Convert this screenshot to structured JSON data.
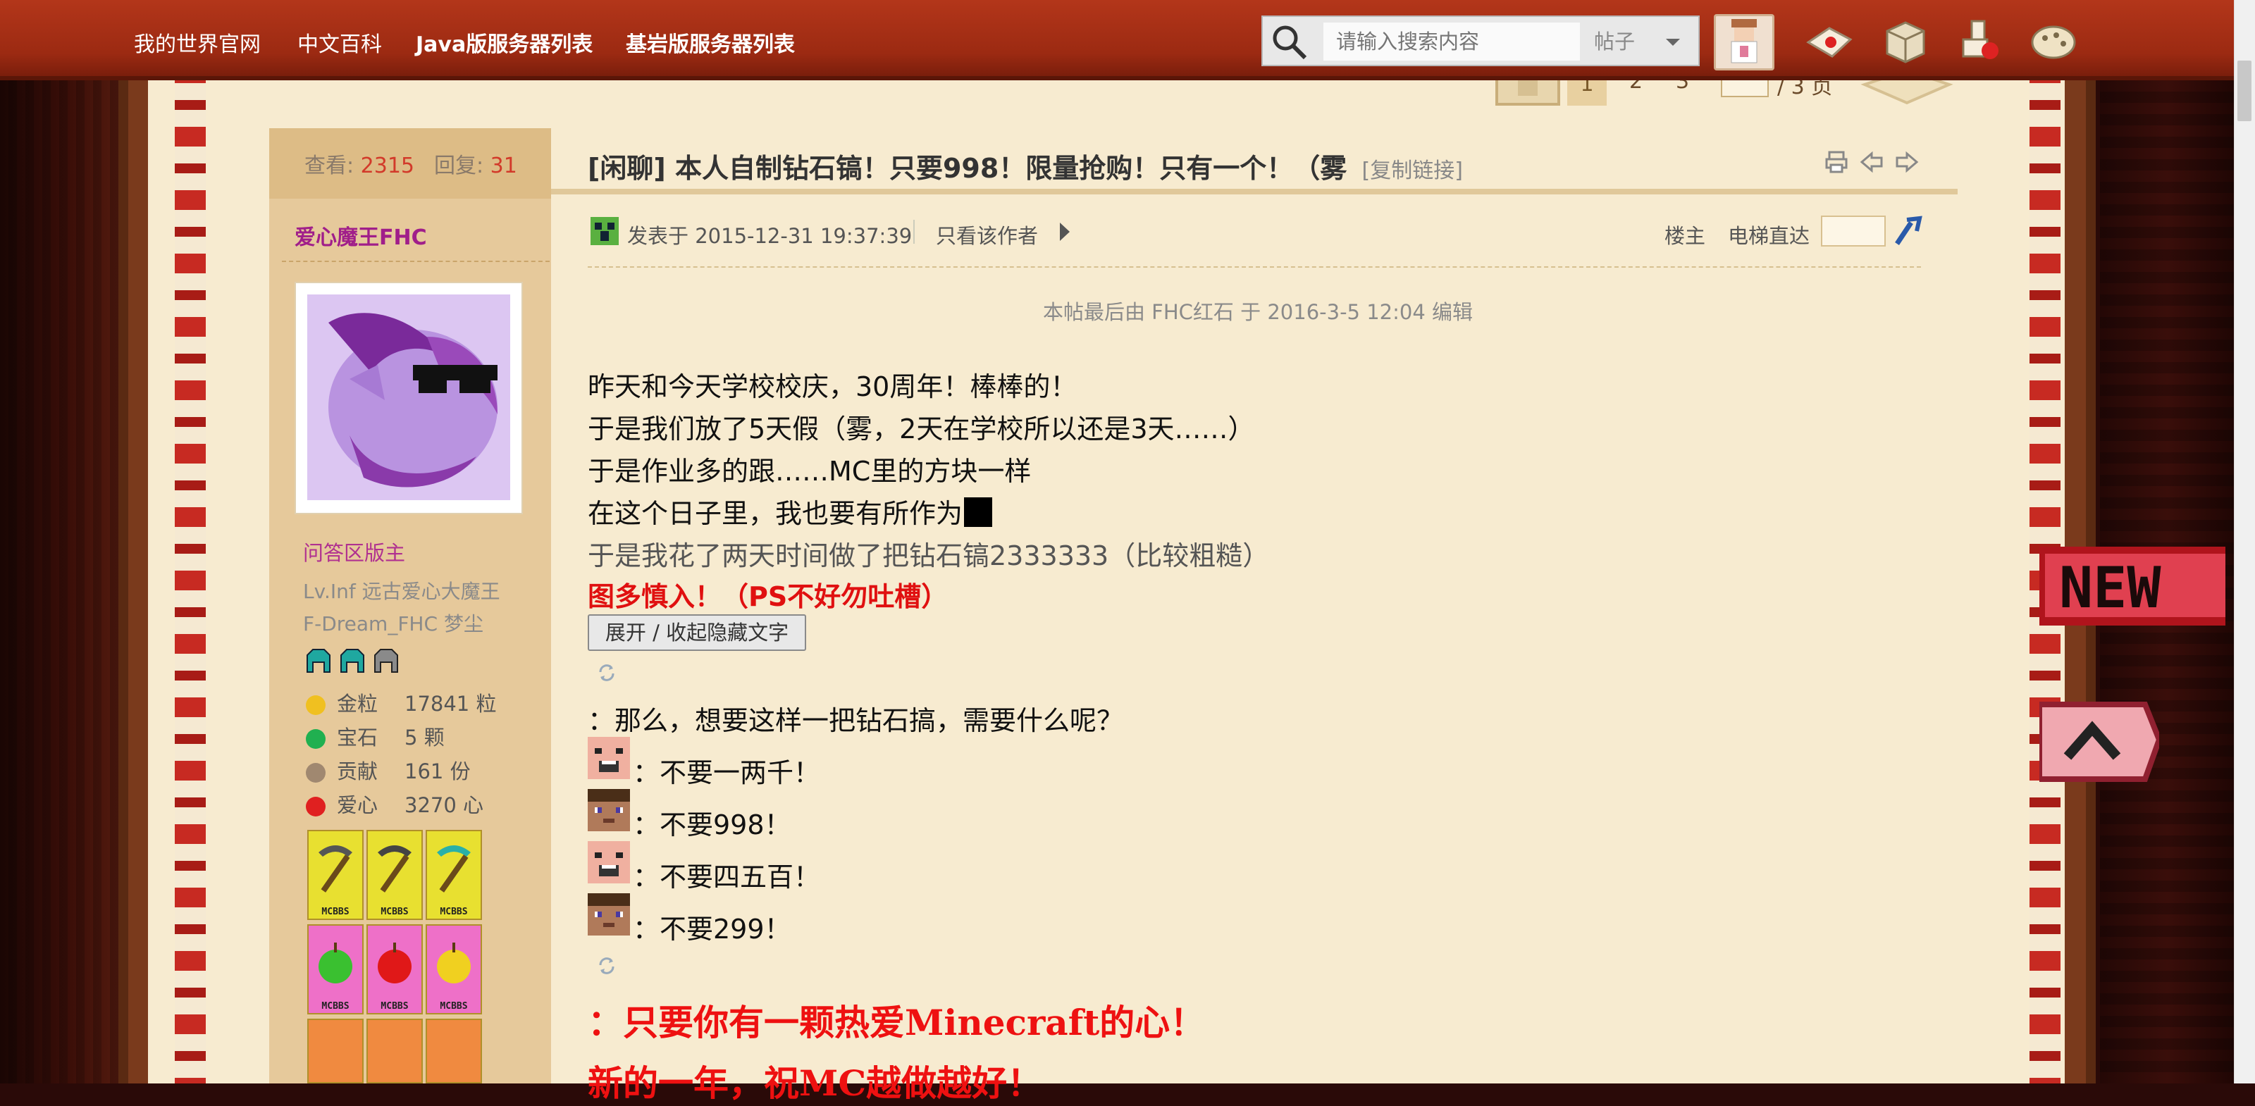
{
  "nav": {
    "links": [
      "我的世界官网",
      "中文百科",
      "Java版服务器列表",
      "基岩版服务器列表"
    ],
    "search_placeholder": "请输入搜索内容",
    "search_type": "帖子"
  },
  "pager": {
    "current": "1",
    "p2": "2",
    "p3": "3",
    "total": "/ 3 页"
  },
  "stats": {
    "views_label": "查看:",
    "views": "2315",
    "replies_label": "回复:",
    "replies": "31"
  },
  "user": {
    "name": "爱心魔王FHC",
    "group": "问答区版主",
    "title1": "Lv.Inf 远古爱心大魔王",
    "title2": "F-Dream_FHC 梦尘",
    "credits": [
      {
        "label": "金粒",
        "value": "17841 粒",
        "color": "#f0c020"
      },
      {
        "label": "宝石",
        "value": "5 颗",
        "color": "#20b050"
      },
      {
        "label": "贡献",
        "value": "161 份",
        "color": "#a08870"
      },
      {
        "label": "爱心",
        "value": "3270 心",
        "color": "#e02020"
      }
    ],
    "badge_text": "MCBBS"
  },
  "post": {
    "title": "[闲聊] 本人自制钻石镐！只要998！限量抢购！只有一个！（雾",
    "copy_link": "[复制链接]",
    "posted_at": "发表于 2015-12-31 19:37:39",
    "only_author": "只看该作者",
    "floor": "楼主",
    "elevator": "电梯直达",
    "edit_note": "本帖最后由 FHC红石 于 2016-3-5 12:04 编辑",
    "lines": [
      "昨天和今天学校校庆，30周年！棒棒的！",
      "于是我们放了5天假（雾，2天在学校所以还是3天……）",
      "于是作业多的跟……MC里的方块一样",
      "在这个日子里，我也要有所作为",
      "于是我花了两天时间做了把钻石镐2333333（比较粗糙）"
    ],
    "warning": "图多慎入！（PS不好勿吐槽）",
    "toggle_label": "展开 / 收起隐藏文字",
    "question": "：那么，想要这样一把钻石搞，需要什么呢？",
    "dialog": [
      "：不要一两千！",
      "：不要998！",
      "：不要四五百！",
      "：不要299！"
    ],
    "finale1": "：只要你有一颗热爱Minecraft的心！",
    "finale2": "新的一年，祝MC越做越好！"
  },
  "widgets": {
    "new_label": "NEW"
  },
  "colors": {
    "nav_bg": "#a62f16",
    "accent_red": "#e01010",
    "username": "#a01e8a"
  }
}
